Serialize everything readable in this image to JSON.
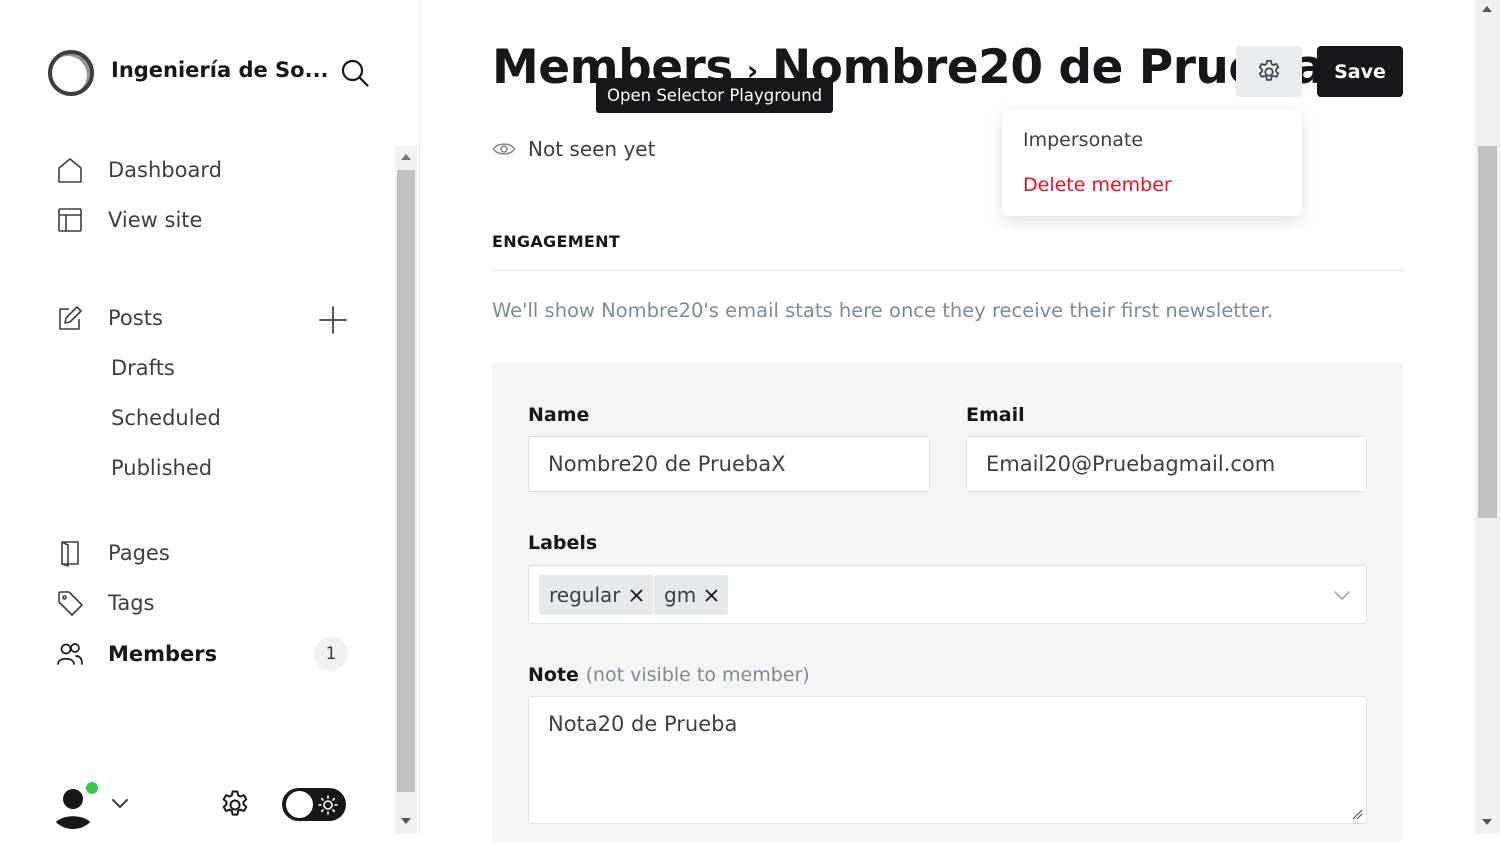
{
  "sidebar": {
    "site_title": "Ingeniería de So...",
    "nav": {
      "dashboard": "Dashboard",
      "view_site": "View site",
      "posts": "Posts",
      "drafts": "Drafts",
      "scheduled": "Scheduled",
      "published": "Published",
      "pages": "Pages",
      "tags": "Tags",
      "members": "Members",
      "members_count": "1"
    },
    "user": {
      "online_status_color": "#30cf43"
    },
    "theme_toggle": {
      "state": "dark"
    }
  },
  "header": {
    "breadcrumb_parent": "Members",
    "breadcrumb_separator": "›",
    "title": "Nombre20 de PruebaX",
    "save_label": "Save"
  },
  "tooltip": {
    "text": "Open Selector Playground"
  },
  "status": {
    "last_seen": "Not seen yet"
  },
  "actions_menu": {
    "impersonate": "Impersonate",
    "delete_member": "Delete member",
    "delete_color": "#f50b23"
  },
  "engagement": {
    "title": "ENGAGEMENT",
    "empty_message": "We'll show Nombre20's email stats here once they receive their first newsletter."
  },
  "form": {
    "name_label": "Name",
    "name_value": "Nombre20 de PruebaX",
    "email_label": "Email",
    "email_value": "Email20@Pruebagmail.com",
    "labels_label": "Labels",
    "labels": [
      "regular",
      "gm"
    ],
    "note_label": "Note",
    "note_hint": "(not visible to member)",
    "note_value": "Nota20 de Prueba"
  },
  "colors": {
    "primary_button": "#15171a",
    "accent_online": "#30cf43",
    "danger": "#f50b23"
  }
}
